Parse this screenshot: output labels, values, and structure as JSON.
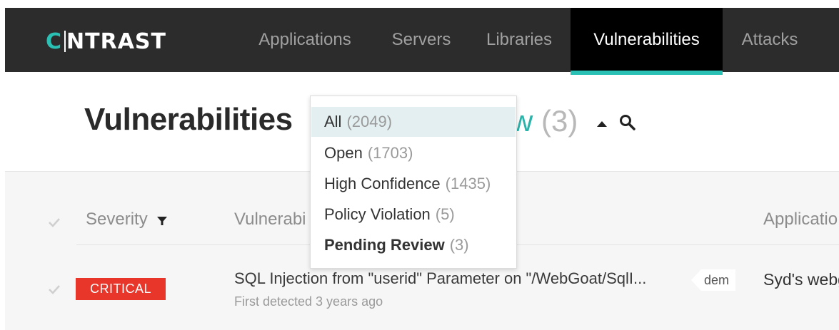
{
  "brand": {
    "logo_text": "NTRAST",
    "logo_mark": "C",
    "accent": "#2bc0b4"
  },
  "nav": {
    "tabs": [
      {
        "label": "Applications",
        "active": false
      },
      {
        "label": "Servers",
        "active": false
      },
      {
        "label": "Libraries",
        "active": false
      },
      {
        "label": "Vulnerabilities",
        "active": true
      },
      {
        "label": "Attacks",
        "active": false
      }
    ]
  },
  "header": {
    "title": "Vulnerabilities",
    "view_letter": "w",
    "view_count": "(3)"
  },
  "filter_menu": {
    "items": [
      {
        "label": "All",
        "count": "(2049)",
        "highlighted": true
      },
      {
        "label": "Open",
        "count": "(1703)"
      },
      {
        "label": "High Confidence",
        "count": "(1435)"
      },
      {
        "label": "Policy Violation",
        "count": "(5)"
      },
      {
        "label": "Pending Review",
        "count": "(3)",
        "selected": true
      }
    ]
  },
  "table": {
    "columns": {
      "severity": "Severity",
      "vulnerability": "Vulnerabi",
      "application": "Applicatio"
    },
    "rows": [
      {
        "severity": "CRITICAL",
        "severity_color": "#e8362b",
        "title": "SQL Injection from \"userid\" Parameter on \"/WebGoat/SqlI...",
        "detected": "First detected 3 years ago",
        "tag": "dem",
        "application": "Syd's webg"
      }
    ]
  }
}
